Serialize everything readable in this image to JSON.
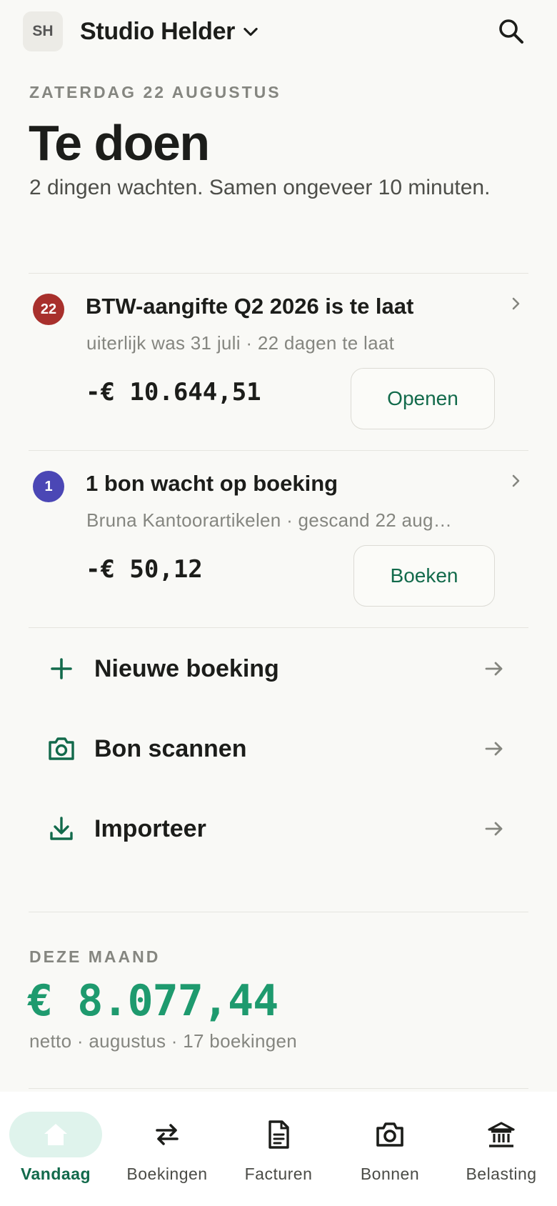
{
  "header": {
    "avatar_initials": "SH",
    "org_name": "Studio Helder"
  },
  "today": {
    "date_label": "ZATERDAG 22 AUGUSTUS",
    "title": "Te doen",
    "subtitle": "2 dingen wachten. Samen ongeveer 10 minuten."
  },
  "tasks": [
    {
      "badge": "22",
      "badge_color": "#a8302c",
      "title": "BTW-aangifte Q2 2026 is te laat",
      "subtitle": "uiterlijk was 31 juli · 22 dagen te laat",
      "amount": "-€ 10.644,51",
      "button": "Openen"
    },
    {
      "badge": "1",
      "badge_color": "#4b47b5",
      "title": "1 bon wacht op boeking",
      "subtitle": "Bruna Kantoorartikelen · gescand 22 aug…",
      "amount": "-€ 50,12",
      "button": "Boeken"
    }
  ],
  "actions": [
    {
      "label": "Nieuwe boeking",
      "icon": "plus-icon"
    },
    {
      "label": "Bon scannen",
      "icon": "camera-icon"
    },
    {
      "label": "Importeer",
      "icon": "download-icon"
    }
  ],
  "month": {
    "label": "DEZE MAAND",
    "amount": "€ 8.077,44",
    "summary": "netto · augustus · 17 boekingen"
  },
  "nav": [
    {
      "label": "Vandaag",
      "icon": "home-icon",
      "active": true
    },
    {
      "label": "Boekingen",
      "icon": "swap-arrows-icon",
      "active": false
    },
    {
      "label": "Facturen",
      "icon": "document-icon",
      "active": false
    },
    {
      "label": "Bonnen",
      "icon": "camera-icon",
      "active": false
    },
    {
      "label": "Belasting",
      "icon": "bank-icon",
      "active": false
    }
  ],
  "colors": {
    "accent": "#126a4b",
    "accent_bright": "#1e9a6e",
    "background": "#f9f9f6"
  }
}
